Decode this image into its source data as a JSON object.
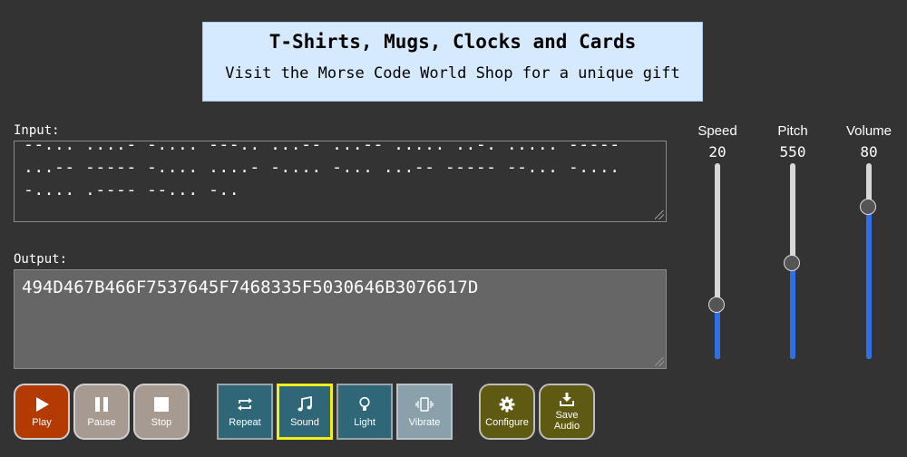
{
  "banner": {
    "title": "T-Shirts, Mugs, Clocks and Cards",
    "subtitle": "Visit the Morse Code World Shop for a unique gift"
  },
  "input": {
    "label": "Input:",
    "value": "--... ....- -.... ---.. ...-- ...-- ..... ..-. ..... -----\n...-- ----- -.... ....- -.... -... ...-- ----- --... -....\n-.... .---- --... -.."
  },
  "output": {
    "label": "Output:",
    "value": "494D467B466F7537645F7468335F5030646B3076617D"
  },
  "sliders": {
    "speed": {
      "label": "Speed",
      "value": "20",
      "level": 0.28
    },
    "pitch": {
      "label": "Pitch",
      "value": "550",
      "level": 0.49
    },
    "volume": {
      "label": "Volume",
      "value": "80",
      "level": 0.78
    }
  },
  "buttons": {
    "play": "Play",
    "pause": "Pause",
    "stop": "Stop",
    "repeat": "Repeat",
    "sound": "Sound",
    "light": "Light",
    "vibrate": "Vibrate",
    "configure": "Configure",
    "save_audio": "Save Audio"
  },
  "colors": {
    "background": "#333333",
    "banner": "#d6eaff",
    "play": "#b33a00",
    "control_grey": "#a79a91",
    "toggle_teal": "#2f6778",
    "selected_outline": "#f2ee1a",
    "olive": "#5e5a12",
    "slider_fill": "#2f6fe6"
  },
  "icons": [
    "play-icon",
    "pause-icon",
    "stop-icon",
    "repeat-icon",
    "music-note-icon",
    "lightbulb-icon",
    "vibrate-icon",
    "gear-icon",
    "download-icon"
  ]
}
